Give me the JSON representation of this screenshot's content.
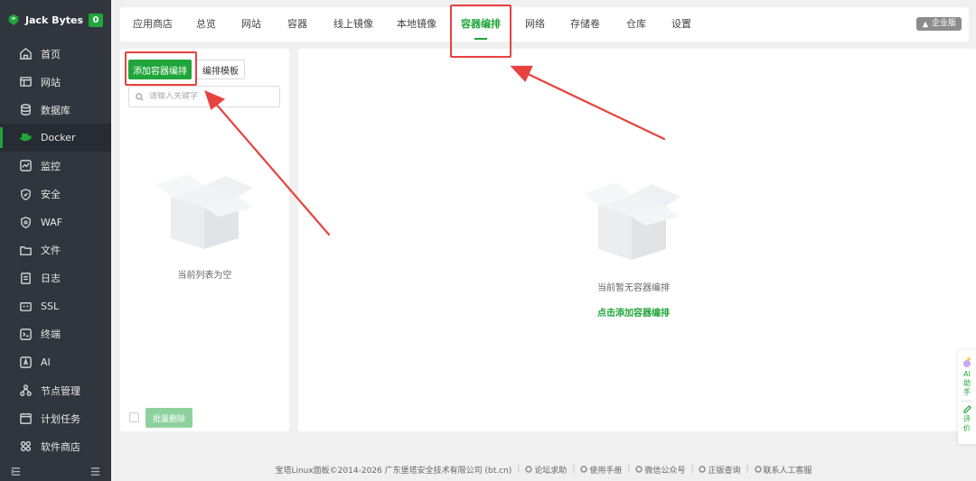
{
  "sidebar": {
    "brand": "Jack Bytes",
    "badge": "0",
    "items": [
      {
        "label": "首页",
        "icon": "home-icon"
      },
      {
        "label": "网站",
        "icon": "website-icon"
      },
      {
        "label": "数据库",
        "icon": "database-icon"
      },
      {
        "label": "Docker",
        "icon": "docker-icon"
      },
      {
        "label": "监控",
        "icon": "monitor-icon"
      },
      {
        "label": "安全",
        "icon": "shield-icon"
      },
      {
        "label": "WAF",
        "icon": "waf-icon"
      },
      {
        "label": "文件",
        "icon": "folder-icon"
      },
      {
        "label": "日志",
        "icon": "log-icon"
      },
      {
        "label": "SSL",
        "icon": "ssl-icon"
      },
      {
        "label": "终端",
        "icon": "terminal-icon"
      },
      {
        "label": "AI",
        "icon": "ai-icon"
      },
      {
        "label": "节点管理",
        "icon": "node-icon"
      },
      {
        "label": "计划任务",
        "icon": "calendar-icon"
      },
      {
        "label": "软件商店",
        "icon": "store-icon"
      }
    ],
    "active_index": 3
  },
  "topnav": {
    "tabs": [
      "应用商店",
      "总览",
      "网站",
      "容器",
      "线上镜像",
      "本地镜像",
      "容器编排",
      "网络",
      "存储卷",
      "仓库",
      "设置"
    ],
    "active_tab": "容器编排",
    "enterprise_label": "企业版"
  },
  "left_panel": {
    "add_button": "添加容器编排",
    "template_button": "编排模板",
    "search_placeholder": "请输入关键字",
    "empty_text": "当前列表为空",
    "batch_delete": "批量删除"
  },
  "main_panel": {
    "empty_text": "当前暂无容器编排",
    "empty_link": "点击添加容器编排"
  },
  "float_widget": {
    "ai_label": "AI助手",
    "review_label": "评价"
  },
  "footer": {
    "copyright": "宝塔Linux面板©2014-2026 广东堡塔安全技术有限公司 (bt.cn)",
    "links": [
      "论坛求助",
      "使用手册",
      "微信公众号",
      "正版查询",
      "联系人工客服"
    ]
  },
  "colors": {
    "accent": "#20a53a",
    "sidebar_bg": "#30353e",
    "annotation_red": "#e8423f"
  }
}
